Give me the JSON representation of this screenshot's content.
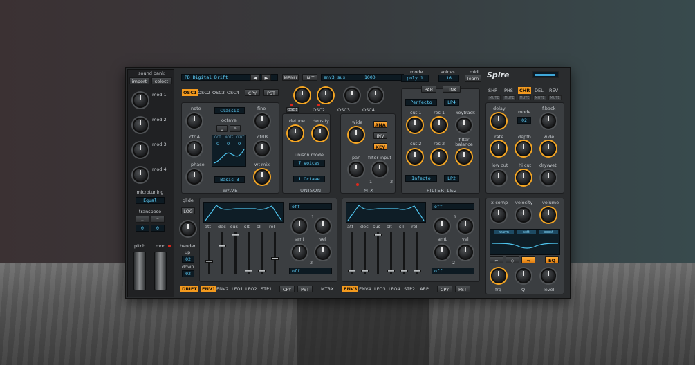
{
  "header": {
    "preset_name": "PD Digital Drift",
    "menu": "MENU",
    "init": "INIT",
    "env_display": "env3 sus",
    "env_value": "1000",
    "mode_label": "mode",
    "mode_value": "poly 1",
    "voices_label": "voices",
    "voices_value": "16",
    "midi_label": "midi",
    "midi_learn": "learn",
    "logo": "Spire"
  },
  "left": {
    "sound_bank": "sound bank",
    "import": "import",
    "select": "select",
    "mods": [
      "mod 1",
      "mod 2",
      "mod 3",
      "mod 4"
    ],
    "microtuning": "microtuning",
    "microtuning_value": "Equal",
    "transpose": "transpose",
    "transpose_value": "0",
    "transpose_value2": "0",
    "pitch": "pitch",
    "mod": "mod"
  },
  "osc_tabs": [
    "OSC1",
    "OSC2",
    "OSC3",
    "OSC4"
  ],
  "cpy": "CPY",
  "pst": "PST",
  "osc_labels": [
    "OSC1",
    "OSC2",
    "OSC3",
    "OSC4"
  ],
  "wave": {
    "note": "note",
    "wave_type": "Classic",
    "fine": "fine",
    "octave": "octave",
    "ctrlA": "ctrlA",
    "ctrlB": "ctrlB",
    "oct_headers": [
      "OCT",
      "NOTE",
      "CENT"
    ],
    "oct_values": [
      "0",
      "0",
      "0"
    ],
    "phase": "phase",
    "wt_mix": "wt mix",
    "waveform": "Basic 3",
    "title": "WAVE"
  },
  "unison": {
    "detune": "detune",
    "density": "density",
    "mode_label": "unison mode",
    "mode_value": "7 voices",
    "octave_value": "1 Octave",
    "title": "UNISON"
  },
  "mix": {
    "wide": "wide",
    "ana": "ANA",
    "inv": "INV",
    "key": "KEY",
    "pan": "pan",
    "filter_input": "filter input",
    "n1": "1",
    "n2": "2",
    "title": "MIX"
  },
  "filter": {
    "par": "PAR",
    "link": "LINK",
    "type1": "Perfecto",
    "mode1": "LP4",
    "cut1": "cut 1",
    "res1": "res 1",
    "keytrack": "keytrack",
    "cut2": "cut 2",
    "res2": "res 2",
    "balance": "filter balance",
    "type2": "Infecto",
    "mode2": "LP2",
    "title": "FILTER 1&2"
  },
  "fx": {
    "tabs": [
      "SHP",
      "PHS",
      "CHR",
      "DEL",
      "REV"
    ],
    "mute": "MUTE",
    "delay": "delay",
    "mode": "mode",
    "mode_value": "02",
    "fback": "f.back",
    "rate": "rate",
    "depth": "depth",
    "wide": "wide",
    "low_cut": "low cut",
    "hi_cut": "hi cut",
    "drywet": "dry/wet"
  },
  "master": {
    "xcomp": "x-comp",
    "velocity": "velocity",
    "volume": "volume",
    "eq_tabs": [
      "warm",
      "soft",
      "boost"
    ],
    "eq": "EQ",
    "frq": "frq",
    "q": "Q",
    "level": "level"
  },
  "glide": {
    "glide": "glide",
    "log": "LOG",
    "bender": "bender",
    "up": "up",
    "up_value": "02",
    "down": "down",
    "down_value": "02",
    "drift": "DRIFT"
  },
  "env1": {
    "fader_labels": [
      "att",
      "dec",
      "sus",
      "slt",
      "sll",
      "rel"
    ],
    "off1": "off",
    "amt": "amt",
    "vel": "vel",
    "off2": "off",
    "n1": "1",
    "n2": "2"
  },
  "env2": {
    "fader_labels": [
      "att",
      "dec",
      "sus",
      "slt",
      "sll",
      "rel"
    ],
    "off1": "off",
    "amt": "amt",
    "vel": "vel",
    "off2": "off",
    "n1": "1",
    "n2": "2"
  },
  "bottom_tabs_left": [
    "ENV1",
    "ENV2",
    "LFO1",
    "LFO2",
    "STP1"
  ],
  "bottom_tabs_right": [
    "ENV3",
    "ENV4",
    "LFO3",
    "LFO4",
    "STP2",
    "ARP"
  ],
  "mtrx": "MTRX"
}
